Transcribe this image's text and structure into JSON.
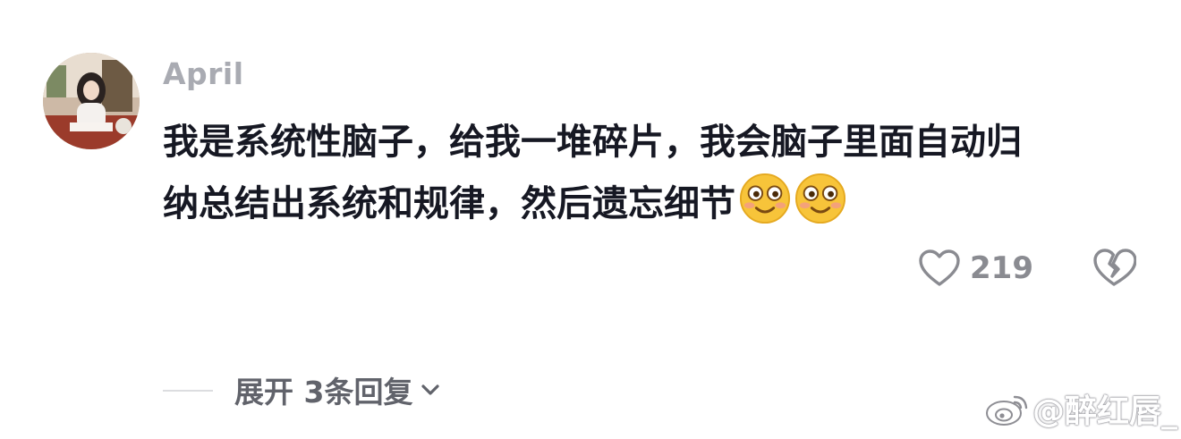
{
  "comment": {
    "username": "April",
    "text_line1": "我是系统性脑子，给我一堆碎片，我会脑子里面自动归",
    "text_line2": "纳总结出系统和规律，然后遗忘细节",
    "emojis": [
      "blushing-face-icon",
      "blushing-face-icon"
    ],
    "like_count": "219",
    "expand_replies_label": "展开 3条回复"
  },
  "watermark": {
    "text": "@醉红唇_"
  },
  "colors": {
    "username": "#a9abb2",
    "text": "#161823",
    "secondary": "#8a8b91",
    "expand": "#61636b"
  }
}
